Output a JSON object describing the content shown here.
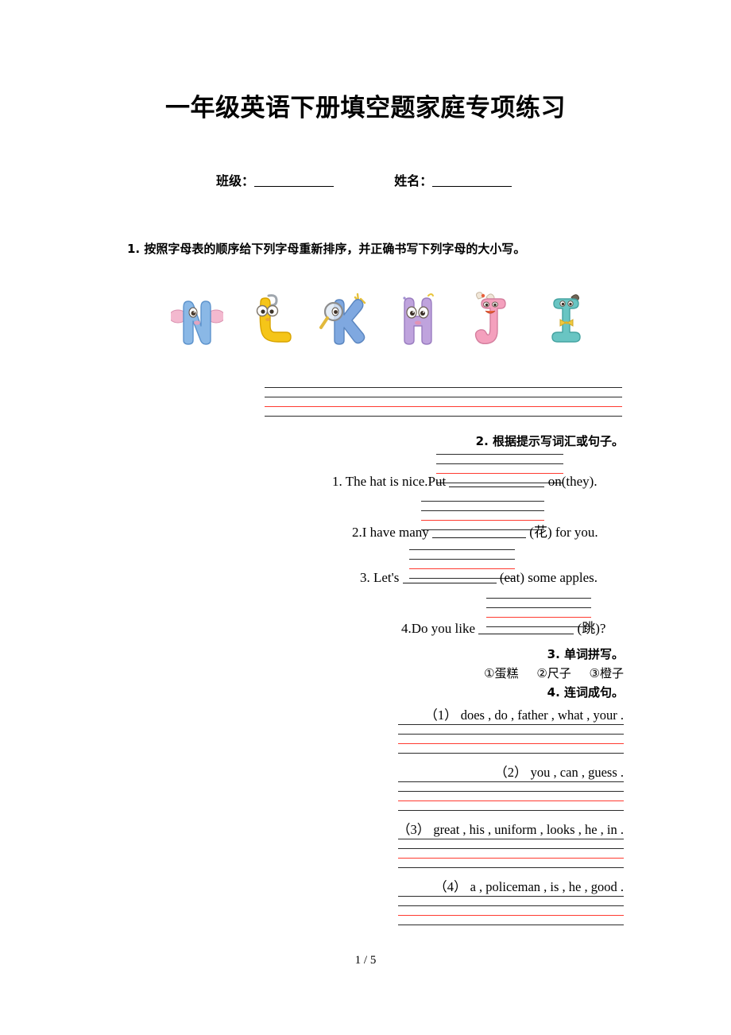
{
  "document": {
    "title": "一年级英语下册填空题家庭专项练习",
    "footer_page": "1 / 5"
  },
  "student_info": {
    "class_label": "班级：",
    "name_label": "姓名："
  },
  "questions": {
    "q1": {
      "heading": "1. 按照字母表的顺序给下列字母重新排序，并正确书写下列字母的大小写。",
      "letters": [
        {
          "letter": "N",
          "color": "#8ab8e6",
          "accent": "#f2b7cf",
          "theme": "elephant"
        },
        {
          "letter": "L",
          "color": "#f5c518",
          "accent": "#ffffff",
          "theme": "glasses"
        },
        {
          "letter": "K",
          "color": "#7fa8e0",
          "accent": "#e8c23a",
          "theme": "magnifier"
        },
        {
          "letter": "H",
          "color": "#bfa3dd",
          "accent": "#ffffff",
          "theme": "eyes"
        },
        {
          "letter": "J",
          "color": "#f4a0bd",
          "accent": "#e8603c",
          "theme": "bow"
        },
        {
          "letter": "I",
          "color": "#69c5c3",
          "accent": "#f0c93c",
          "theme": "bowtie"
        }
      ]
    },
    "q2": {
      "heading": "2. 根据提示写词汇或句子。",
      "items": [
        {
          "prefix": "1. The hat is nice.Put",
          "suffix": "on(they)."
        },
        {
          "prefix": "2.I have many",
          "suffix": "(花) for you."
        },
        {
          "prefix": "3. Let's",
          "suffix": "(eat) some apples."
        },
        {
          "prefix": "4.Do you like",
          "suffix": "(跳)?"
        }
      ]
    },
    "q3": {
      "heading": "3. 单词拼写。",
      "options": [
        "①蛋糕",
        "②尺子",
        "③橙子"
      ]
    },
    "q4": {
      "heading": "4. 连词成句。",
      "items": [
        "（1） does , do , father , what , your .",
        "（2） you , can , guess .",
        "（3） great , his , uniform , looks , he , in .",
        "（4） a , policeman , is , he , good ."
      ]
    }
  },
  "colors": {
    "rule_black": "#2b2b2b",
    "rule_red": "#ff3b30",
    "text": "#000000"
  }
}
